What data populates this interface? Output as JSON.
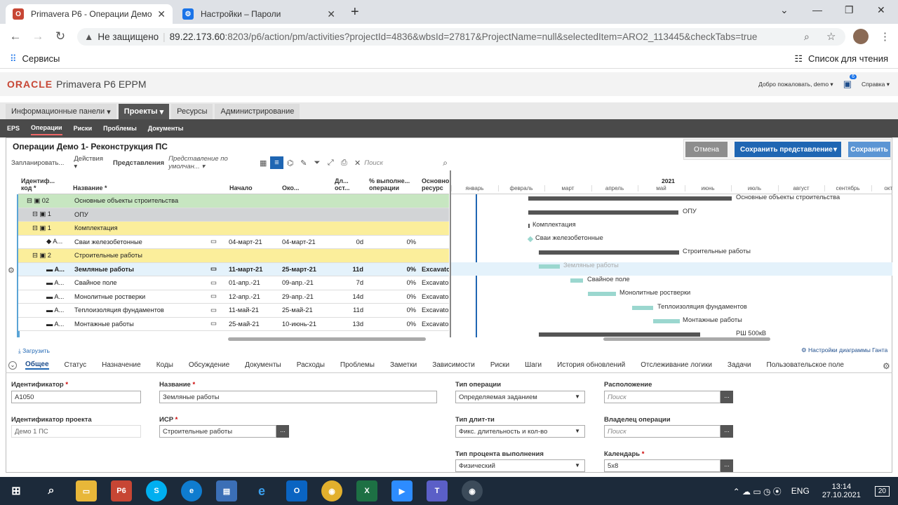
{
  "browser": {
    "tabs": [
      {
        "title": "Primavera P6 - Операции Демо",
        "fav": "P6"
      },
      {
        "title": "Настройки – Пароли",
        "fav": "⚙"
      }
    ],
    "url_warn": "Не защищено",
    "url_host": "89.22.173.60",
    "url_rest": ":8203/p6/action/pm/activities?projectId=4836&wbsId=27817&ProjectName=null&selectedItem=ARO2_113445&checkTabs=true",
    "bookmark": "Сервисы",
    "reading_list": "Список для чтения"
  },
  "app": {
    "brand": "ORACLE",
    "product": "Primavera P6 EPPM",
    "welcome": "Добро пожаловать, demo",
    "notif_count": "6",
    "help": "Справка",
    "nav": [
      "Информационные панели",
      "Проекты",
      "Ресурсы",
      "Администрирование"
    ],
    "subnav": [
      "EPS",
      "Операции",
      "Риски",
      "Проблемы",
      "Документы"
    ],
    "page_title": "Операции Демо 1- Реконструкция ПС",
    "cancel_btn": "Отмена",
    "save_view_btn": "Сохранить представление",
    "save_btn": "Сохранить",
    "actions": [
      "Запланировать...",
      "Действия",
      "Представления"
    ],
    "view_name": "Представление по умолчан...",
    "search_placeholder": "Поиск"
  },
  "grid": {
    "headers": {
      "id": "Идентиф... код *",
      "name": "Название *",
      "start": "Начало",
      "finish": "Око...",
      "dur": "Дл... ост...",
      "pct": "% выполне... операции",
      "res": "Основно ресурс"
    },
    "rows": [
      {
        "lvl": 0,
        "id": "02",
        "name": "Основные объекты строительства",
        "start": "",
        "finish": "",
        "dur": "",
        "pct": "",
        "res": "",
        "type": "wbs0"
      },
      {
        "lvl": 1,
        "id": "1",
        "name": "ОПУ",
        "start": "",
        "finish": "",
        "dur": "",
        "pct": "",
        "res": "",
        "type": "wbs1"
      },
      {
        "lvl": 2,
        "id": "1",
        "name": "Комплектация",
        "start": "",
        "finish": "",
        "dur": "",
        "pct": "",
        "res": "",
        "type": "wbs2"
      },
      {
        "lvl": 3,
        "id": "A...",
        "name": "Сваи железобетонные",
        "start": "04-март-21",
        "finish": "04-март-21",
        "dur": "0d",
        "pct": "0%",
        "res": "",
        "type": "act"
      },
      {
        "lvl": 2,
        "id": "2",
        "name": "Строительные работы",
        "start": "",
        "finish": "",
        "dur": "",
        "pct": "",
        "res": "",
        "type": "wbs2"
      },
      {
        "lvl": 3,
        "id": "A...",
        "name": "Земляные работы",
        "start": "11-март-21",
        "finish": "25-март-21",
        "dur": "11d",
        "pct": "0%",
        "res": "Excavator",
        "type": "sel"
      },
      {
        "lvl": 3,
        "id": "A...",
        "name": "Свайное поле",
        "start": "01-апр.-21",
        "finish": "09-апр.-21",
        "dur": "7d",
        "pct": "0%",
        "res": "Excavator",
        "type": "act"
      },
      {
        "lvl": 3,
        "id": "A...",
        "name": "Монолитные ростверки",
        "start": "12-апр.-21",
        "finish": "29-апр.-21",
        "dur": "14d",
        "pct": "0%",
        "res": "Excavator",
        "type": "act"
      },
      {
        "lvl": 3,
        "id": "A...",
        "name": "Теплоизоляция фундаментов",
        "start": "11-май-21",
        "finish": "25-май-21",
        "dur": "11d",
        "pct": "0%",
        "res": "Excavator",
        "type": "act"
      },
      {
        "lvl": 3,
        "id": "A...",
        "name": "Монтажные работы",
        "start": "25-май-21",
        "finish": "10-июнь-21",
        "dur": "13d",
        "pct": "0%",
        "res": "Excavator",
        "type": "act"
      }
    ],
    "load_link": "Загрузить"
  },
  "gantt": {
    "year": "2021",
    "months": [
      "январь",
      "февраль",
      "март",
      "апрель",
      "май",
      "июнь",
      "июль",
      "август",
      "сентябрь",
      "октябрь"
    ],
    "settings_link": "Настройки диаграммы Ганта",
    "labels": [
      "Основные объекты строительства",
      "ОПУ",
      "Комплектация",
      "Сваи железобетонные",
      "Строительные работы",
      "Земляные работы",
      "Свайное поле",
      "Монолитные ростверки",
      "Теплоизоляция фундаментов",
      "Монтажные работы",
      "РШ 500кВ"
    ]
  },
  "detail": {
    "tabs": [
      "Общее",
      "Статус",
      "Назначение",
      "Коды",
      "Обсуждение",
      "Документы",
      "Расходы",
      "Проблемы",
      "Заметки",
      "Зависимости",
      "Риски",
      "Шаги",
      "История обновлений",
      "Отслеживание логики",
      "Задачи",
      "Пользовательское поле"
    ],
    "fields": {
      "id_label": "Идентификатор",
      "id_value": "A1050",
      "name_label": "Название",
      "name_value": "Земляные работы",
      "proj_label": "Идентификатор проекта",
      "proj_value": "Демо 1 ПС",
      "wbs_label": "ИСР",
      "wbs_value": "Строительные работы",
      "optype_label": "Тип операции",
      "optype_value": "Определяемая заданием",
      "durtype_label": "Тип длит-ти",
      "durtype_value": "Фикс. длительность и кол-во",
      "pcttype_label": "Тип процента выполнения",
      "pcttype_value": "Физический",
      "loc_label": "Расположение",
      "loc_ph": "Поиск",
      "owner_label": "Владелец операции",
      "owner_ph": "Поиск",
      "cal_label": "Календарь",
      "cal_value": "5x8"
    }
  },
  "taskbar": {
    "lang": "ENG",
    "time": "13:14",
    "date": "27.10.2021",
    "notif": "20"
  }
}
